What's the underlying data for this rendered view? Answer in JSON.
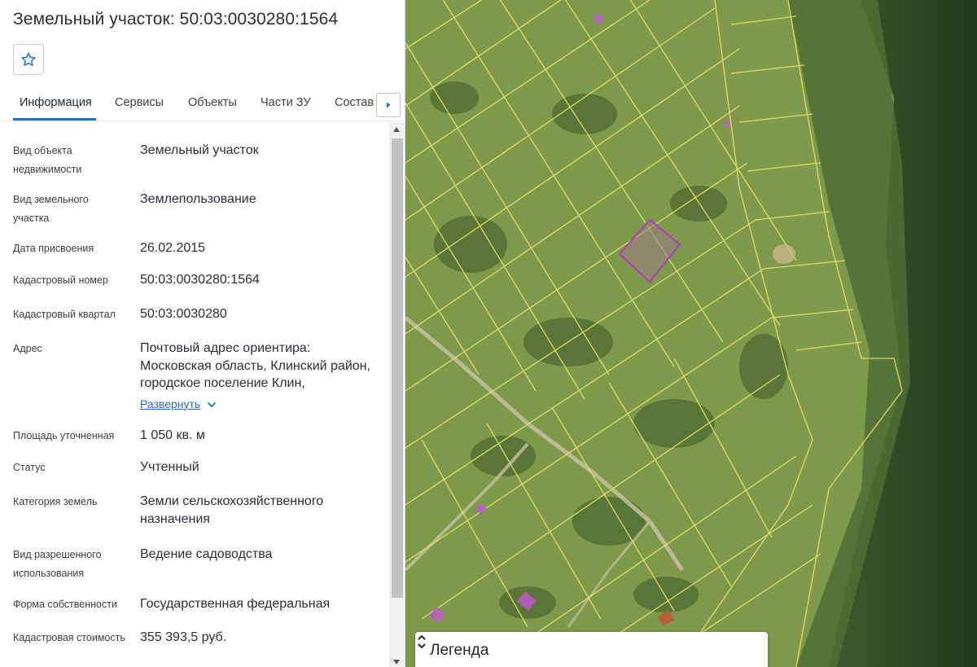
{
  "header": {
    "title": "Земельный участок: 50:03:0030280:1564"
  },
  "favorite": {
    "icon": "star-outline-icon"
  },
  "tabs": [
    {
      "label": "Информация",
      "active": true
    },
    {
      "label": "Сервисы",
      "active": false
    },
    {
      "label": "Объекты",
      "active": false
    },
    {
      "label": "Части ЗУ",
      "active": false
    },
    {
      "label": "Состав",
      "active": false
    }
  ],
  "tabs_scroll_icon": "caret-right-icon",
  "info": {
    "object_type": {
      "label": "Вид объекта недвижимости",
      "value": "Земельный участок"
    },
    "parcel_type": {
      "label": "Вид земельного участка",
      "value": "Землепользование"
    },
    "assigned_date": {
      "label": "Дата присвоения",
      "value": "26.02.2015"
    },
    "cadastral_number": {
      "label": "Кадастровый номер",
      "value": "50:03:0030280:1564"
    },
    "cadastral_quarter": {
      "label": "Кадастровый квартал",
      "value": "50:03:0030280"
    },
    "address": {
      "label": "Адрес",
      "value": "Почтовый адрес ориентира: Московская область, Клинский район, городское поселение Клин,",
      "expand_label": "Развернуть"
    },
    "area": {
      "label": "Площадь уточненная",
      "value": "1 050 кв. м"
    },
    "status": {
      "label": "Статус",
      "value": "Учтенный"
    },
    "land_category": {
      "label": "Категория земель",
      "value": "Земли сельскохозяйственного назначения"
    },
    "permitted_use": {
      "label": "Вид разрешенного использования",
      "value": "Ведение садоводства"
    },
    "ownership": {
      "label": "Форма собственности",
      "value": "Государственная федеральная"
    },
    "cadastral_value": {
      "label": "Кадастровая стоимость",
      "value": "355 393,5 руб."
    }
  },
  "map": {
    "legend_title": "Легенда",
    "legend_icon": "chevron-up-down-icon",
    "colors": {
      "boundary": "#e8e36a",
      "selected": "#b23bc0",
      "building": "#c05ad0"
    }
  },
  "colors": {
    "accent": "#1f6fd1",
    "text": "#2b2f36"
  }
}
